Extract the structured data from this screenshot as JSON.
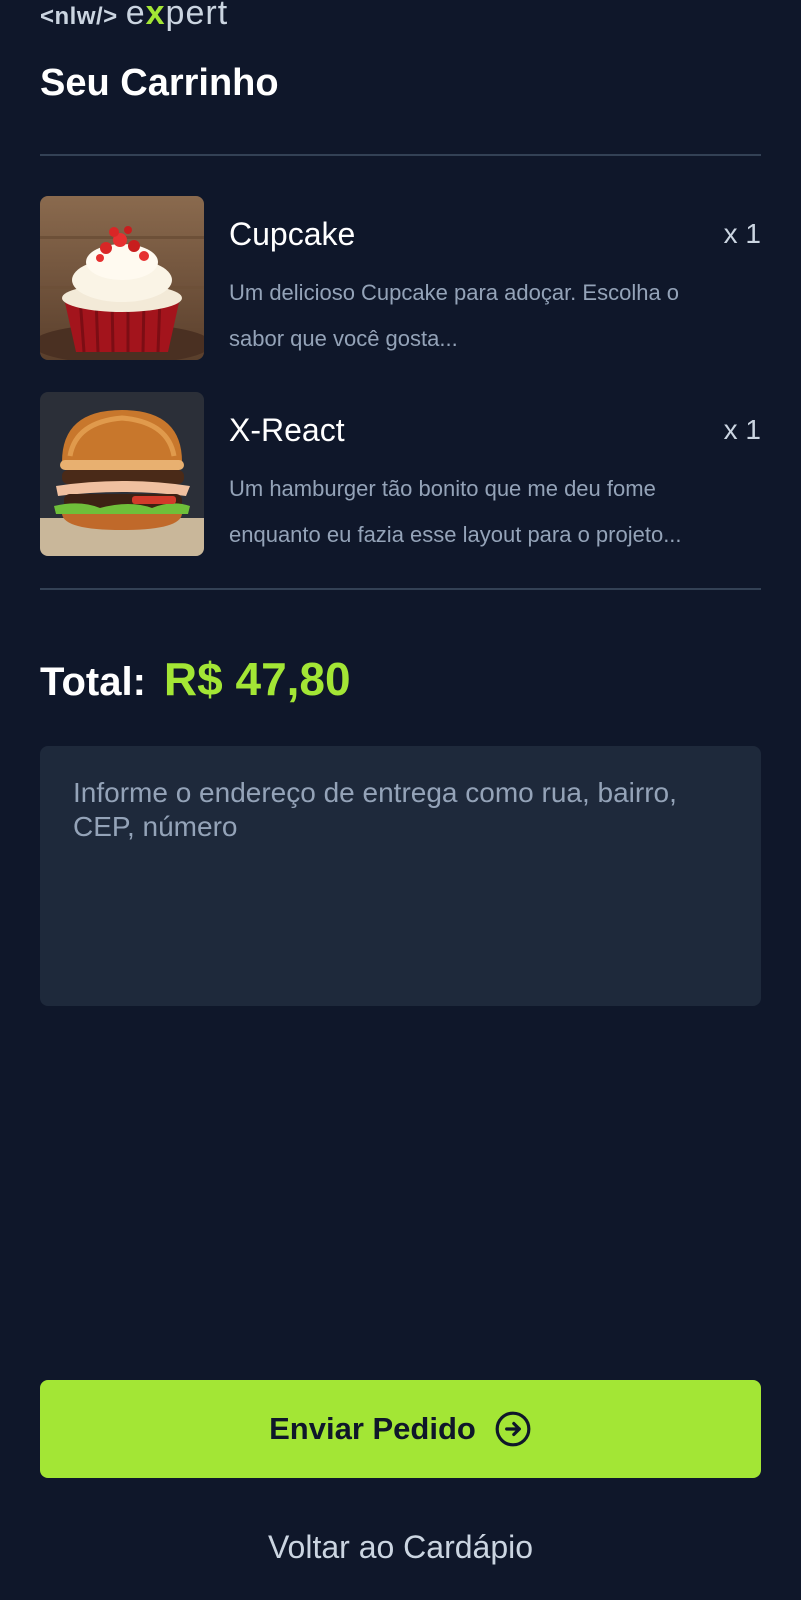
{
  "header": {
    "logo_code": "<nlw/>",
    "logo_word_start": "e",
    "logo_word_x": "x",
    "logo_word_end": "pert",
    "title": "Seu Carrinho"
  },
  "cart": {
    "items": [
      {
        "name": "Cupcake",
        "quantity": "x 1",
        "description": "Um delicioso Cupcake para adoçar. Escolha o sabor que você gosta...",
        "image": "cupcake-photo"
      },
      {
        "name": "X-React",
        "quantity": "x 1",
        "description": "Um hamburger tão bonito que me deu fome enquanto eu fazia esse layout para o projeto...",
        "image": "burger-photo"
      }
    ]
  },
  "summary": {
    "total_label": "Total:",
    "total_value": "R$ 47,80"
  },
  "address": {
    "value": "",
    "placeholder": "Informe o endereço de entrega como rua, bairro, CEP, número"
  },
  "actions": {
    "send_label": "Enviar Pedido",
    "send_icon": "arrow-circle-right-icon",
    "back_label": "Voltar ao Cardápio"
  },
  "colors": {
    "background": "#0f172a",
    "accent": "#a3e635",
    "input_background": "#1e293b",
    "divider": "#334155",
    "muted_text": "#94a3b8"
  }
}
